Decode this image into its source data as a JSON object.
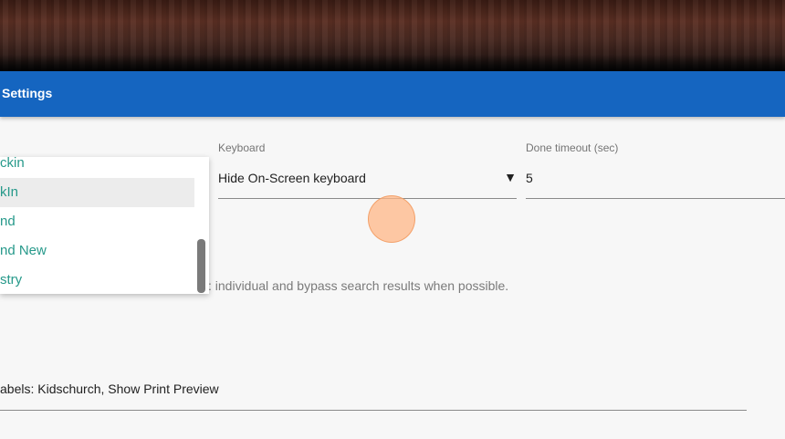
{
  "app_bar": {
    "title": "Settings"
  },
  "colors": {
    "app_bar_bg": "#1565c0",
    "list_text": "#26998a",
    "touch_indicator": "#ffb787"
  },
  "keyboard": {
    "label": "Keyboard",
    "value": "Hide On-Screen keyboard",
    "arrow": "▼"
  },
  "done_timeout": {
    "label": "Done timeout (sec)",
    "value": "5"
  },
  "popup_list": {
    "items": [
      "ckin",
      "kIn",
      "nd",
      "nd New",
      "stry"
    ],
    "selected_index": 1
  },
  "search_hint": ": individual and bypass search results when possible.",
  "print_settings": {
    "text": "abels: Kidschurch,  Show Print Preview"
  }
}
